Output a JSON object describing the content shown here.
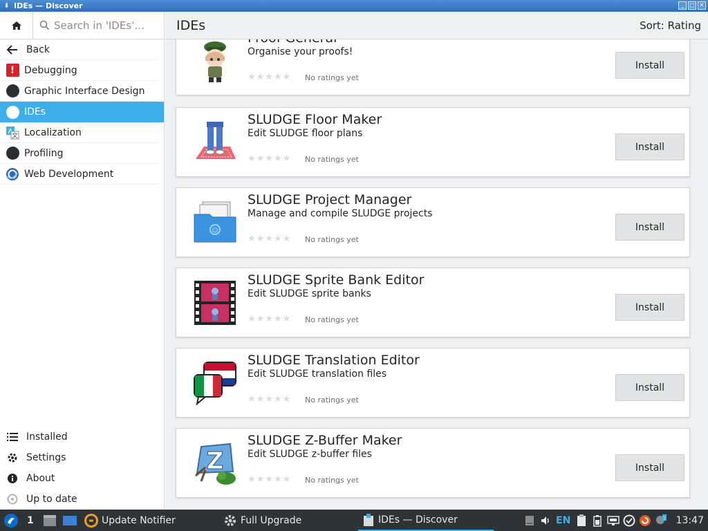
{
  "window": {
    "title": "IDEs — Discover"
  },
  "sidebar": {
    "search_placeholder": "Search in 'IDEs'…",
    "items": [
      {
        "label": "Back",
        "icon": "back-arrow-icon"
      },
      {
        "label": "Debugging",
        "icon": "debugging-icon"
      },
      {
        "label": "Graphic Interface Design",
        "icon": "graphic-design-icon"
      },
      {
        "label": "IDEs",
        "icon": "ides-icon",
        "active": true
      },
      {
        "label": "Localization",
        "icon": "localization-icon"
      },
      {
        "label": "Profiling",
        "icon": "profiling-icon"
      },
      {
        "label": "Web Development",
        "icon": "web-development-icon"
      }
    ],
    "bottom_items": [
      {
        "label": "Installed",
        "icon": "list-icon"
      },
      {
        "label": "Settings",
        "icon": "gear-icon"
      },
      {
        "label": "About",
        "icon": "info-icon"
      },
      {
        "label": "Up to date",
        "icon": "update-icon"
      }
    ]
  },
  "header": {
    "title": "IDEs",
    "sort_label": "Sort: Rating"
  },
  "apps": [
    {
      "name": "Proof General",
      "summary": "Organise your proofs!",
      "rating": "No ratings yet",
      "install_label": "Install"
    },
    {
      "name": "SLUDGE Floor Maker",
      "summary": "Edit SLUDGE floor plans",
      "rating": "No ratings yet",
      "install_label": "Install"
    },
    {
      "name": "SLUDGE Project Manager",
      "summary": "Manage and compile SLUDGE projects",
      "rating": "No ratings yet",
      "install_label": "Install"
    },
    {
      "name": "SLUDGE Sprite Bank Editor",
      "summary": "Edit SLUDGE sprite banks",
      "rating": "No ratings yet",
      "install_label": "Install"
    },
    {
      "name": "SLUDGE Translation Editor",
      "summary": "Edit SLUDGE translation files",
      "rating": "No ratings yet",
      "install_label": "Install"
    },
    {
      "name": "SLUDGE Z-Buffer Maker",
      "summary": "Edit SLUDGE z-buffer files",
      "rating": "No ratings yet",
      "install_label": "Install"
    }
  ],
  "taskbar": {
    "desktop_number": "1",
    "tasks": [
      {
        "label": "Update Notifier"
      },
      {
        "label": "Full Upgrade"
      },
      {
        "label": "IDEs — Discover",
        "active": true
      }
    ],
    "keyboard_layout": "EN",
    "clock": "13:47"
  },
  "colors": {
    "accent": "#3daee9",
    "titlebar": "#3b7ec6",
    "taskbar": "#2e3338"
  }
}
